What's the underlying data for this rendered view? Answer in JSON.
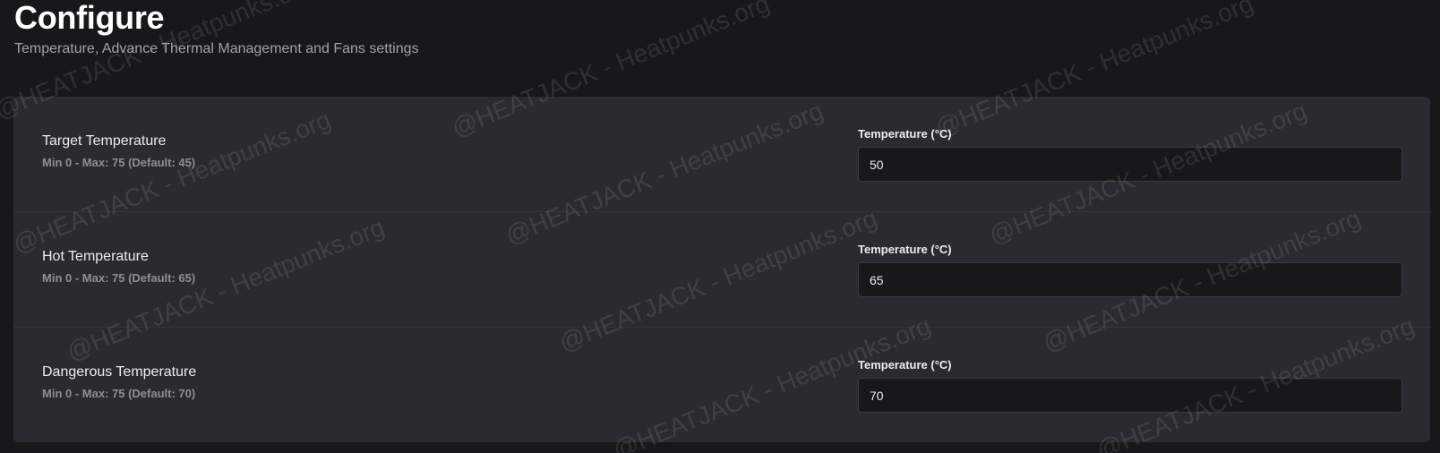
{
  "header": {
    "title": "Configure",
    "subtitle": "Temperature, Advance Thermal Management and Fans settings"
  },
  "settings": [
    {
      "label": "Target Temperature",
      "hint": "Min 0 - Max: 75 (Default: 45)",
      "field_label": "Temperature (°C)",
      "value": "50"
    },
    {
      "label": "Hot Temperature",
      "hint": "Min 0 - Max: 75 (Default: 65)",
      "field_label": "Temperature (°C)",
      "value": "65"
    },
    {
      "label": "Dangerous Temperature",
      "hint": "Min 0 - Max: 75 (Default: 70)",
      "field_label": "Temperature (°C)",
      "value": "70"
    }
  ],
  "watermark": {
    "text": "@HEATJACK - Heatpunks.org"
  }
}
